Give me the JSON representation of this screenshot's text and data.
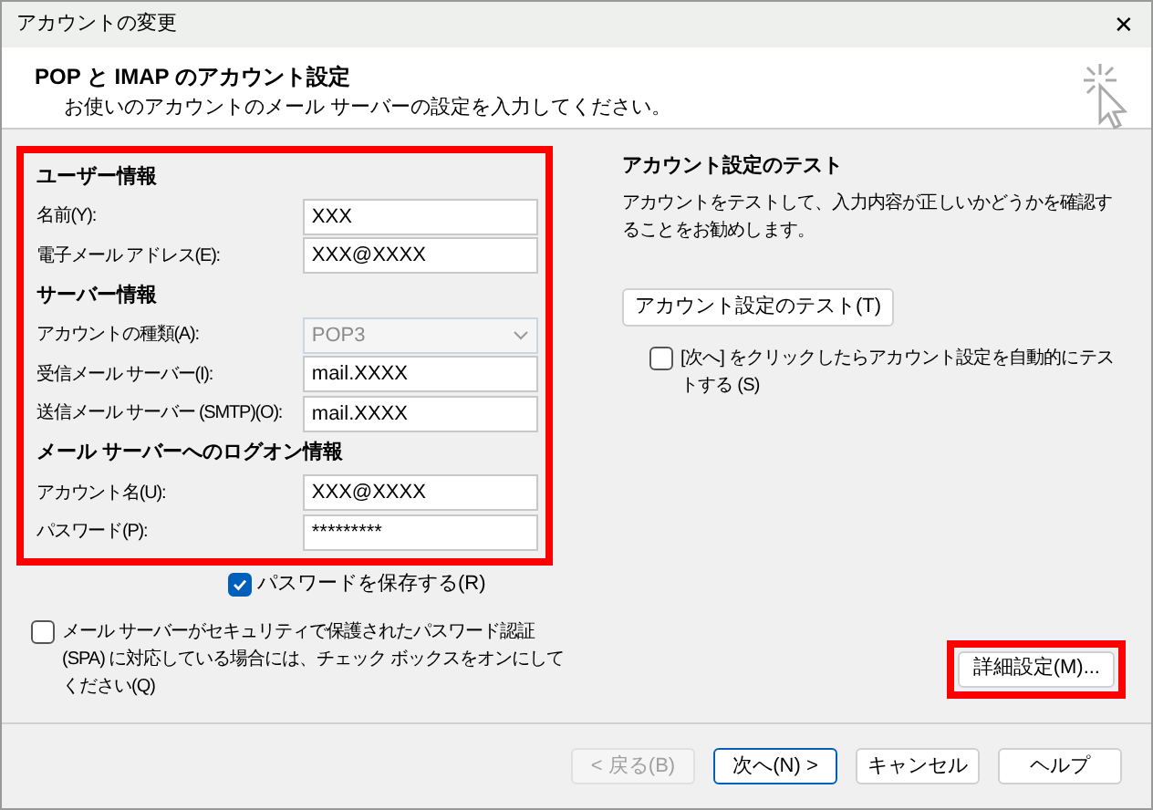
{
  "window": {
    "title": "アカウントの変更",
    "close": "✕"
  },
  "header": {
    "title": "POP と IMAP のアカウント設定",
    "subtitle": "お使いのアカウントのメール サーバーの設定を入力してください。"
  },
  "sections": [
    {
      "title": "ユーザー情報",
      "fields": [
        {
          "label": "名前(Y):",
          "value": "XXX",
          "kind": "text",
          "disabled": false
        },
        {
          "label": "電子メール アドレス(E):",
          "value": "XXX@XXXX",
          "kind": "text",
          "disabled": false
        }
      ]
    },
    {
      "title": "サーバー情報",
      "fields": [
        {
          "label": "アカウントの種類(A):",
          "value": "POP3",
          "kind": "combo",
          "disabled": true
        },
        {
          "label": "受信メール サーバー(I):",
          "value": "mail.XXXX",
          "kind": "text",
          "disabled": false
        },
        {
          "label": "送信メール サーバー (SMTP)(O):",
          "value": "mail.XXXX",
          "kind": "text",
          "disabled": false
        }
      ]
    },
    {
      "title": "メール サーバーへのログオン情報",
      "fields": [
        {
          "label": "アカウント名(U):",
          "value": "XXX@XXXX",
          "kind": "text",
          "disabled": false
        },
        {
          "label": "パスワード(P):",
          "value": "*********",
          "kind": "password",
          "disabled": false
        }
      ]
    }
  ],
  "remember_password": {
    "label": "パスワードを保存する(R)",
    "checked": true
  },
  "spa": {
    "label": "メール サーバーがセキュリティで保護されたパスワード認証 (SPA) に対応している場合には、チェック ボックスをオンにしてください(Q)",
    "checked": false
  },
  "test": {
    "title": "アカウント設定のテスト",
    "description": "アカウントをテストして、入力内容が正しいかどうかを確認することをお勧めします。",
    "button": "アカウント設定のテスト(T)",
    "auto_test": {
      "label": "[次へ] をクリックしたらアカウント設定を自動的にテストする (S)",
      "checked": false
    }
  },
  "advanced_button": "詳細設定(M)...",
  "buttons": [
    {
      "label": "< 戻る(B)",
      "disabled": true,
      "default": false
    },
    {
      "label": "次へ(N) >",
      "disabled": false,
      "default": true
    },
    {
      "label": "キャンセル",
      "disabled": false,
      "default": false
    },
    {
      "label": "ヘルプ",
      "disabled": false,
      "default": false
    }
  ]
}
